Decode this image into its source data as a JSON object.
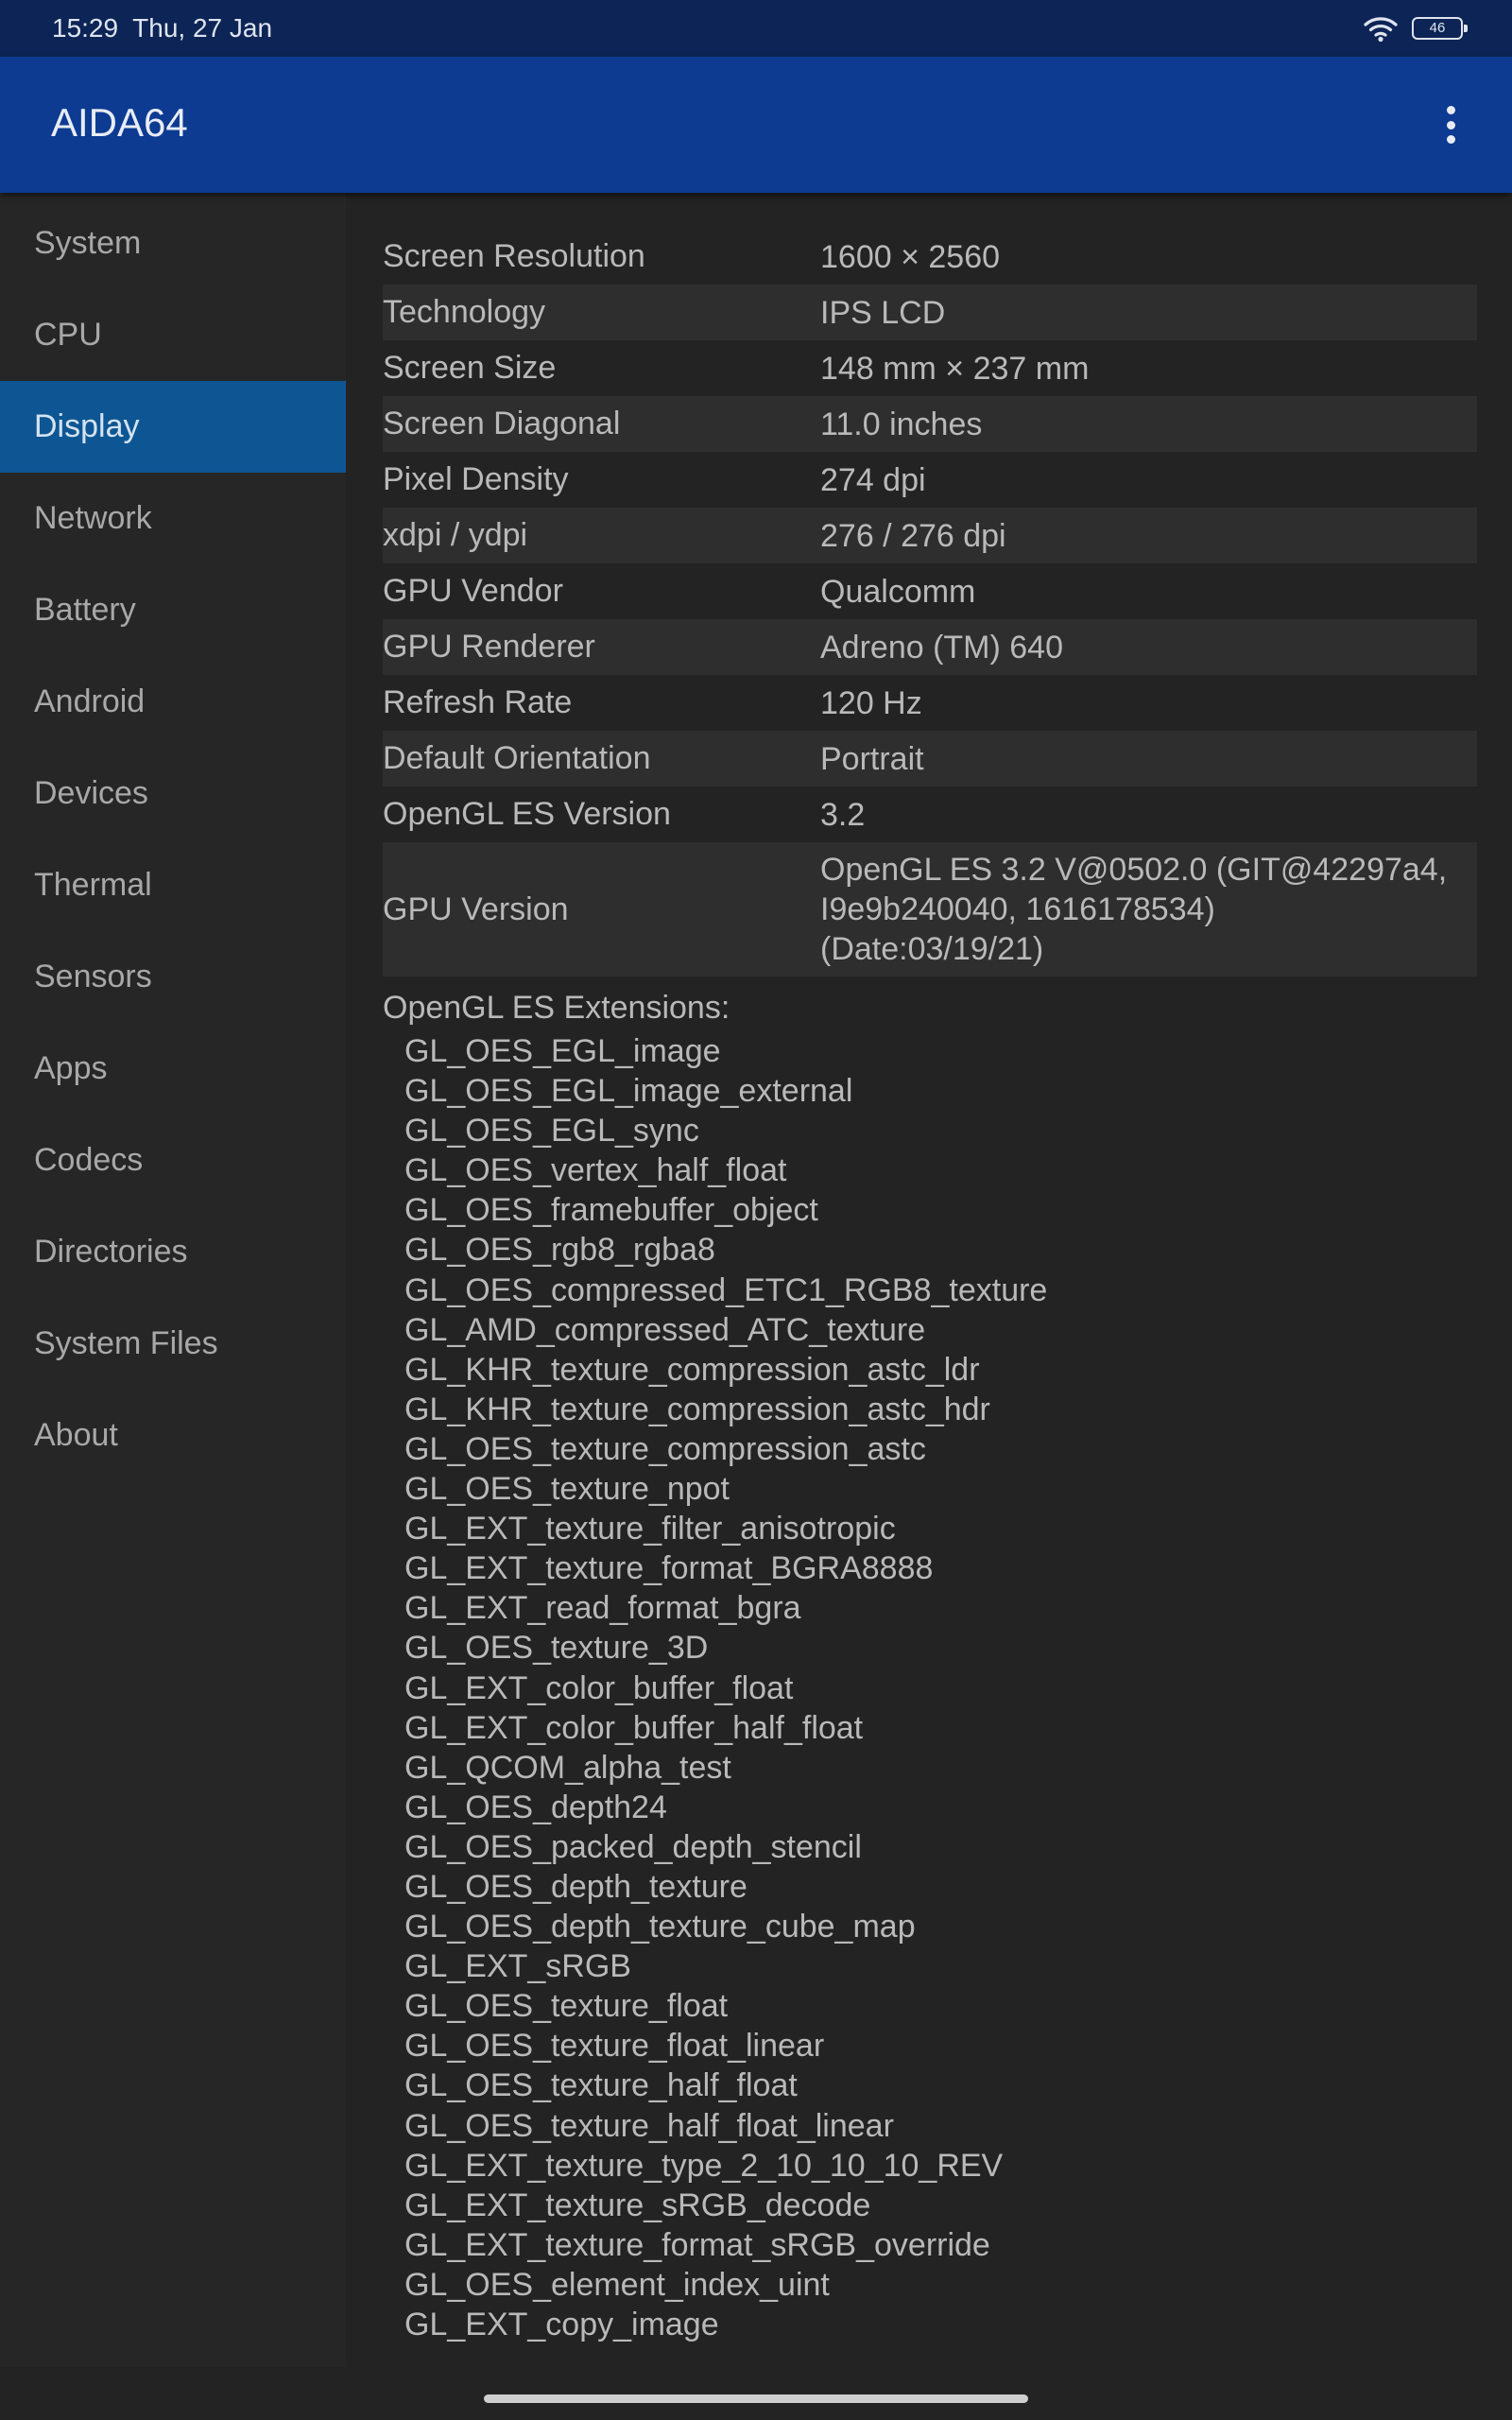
{
  "status": {
    "time": "15:29",
    "date": "Thu, 27 Jan",
    "battery": "46"
  },
  "app": {
    "title": "AIDA64"
  },
  "nav": [
    {
      "label": "System"
    },
    {
      "label": "CPU"
    },
    {
      "label": "Display"
    },
    {
      "label": "Network"
    },
    {
      "label": "Battery"
    },
    {
      "label": "Android"
    },
    {
      "label": "Devices"
    },
    {
      "label": "Thermal"
    },
    {
      "label": "Sensors"
    },
    {
      "label": "Apps"
    },
    {
      "label": "Codecs"
    },
    {
      "label": "Directories"
    },
    {
      "label": "System Files"
    },
    {
      "label": "About"
    }
  ],
  "selected_nav": "Display",
  "display": [
    {
      "label": "Screen Resolution",
      "value": "1600 × 2560"
    },
    {
      "label": "Technology",
      "value": "IPS LCD"
    },
    {
      "label": "Screen Size",
      "value": "148 mm × 237 mm"
    },
    {
      "label": "Screen Diagonal",
      "value": "11.0 inches"
    },
    {
      "label": "Pixel Density",
      "value": "274 dpi"
    },
    {
      "label": "xdpi / ydpi",
      "value": "276 / 276 dpi"
    },
    {
      "label": "GPU Vendor",
      "value": "Qualcomm"
    },
    {
      "label": "GPU Renderer",
      "value": "Adreno (TM) 640"
    },
    {
      "label": "Refresh Rate",
      "value": "120 Hz"
    },
    {
      "label": "Default Orientation",
      "value": "Portrait"
    },
    {
      "label": "OpenGL ES Version",
      "value": "3.2"
    }
  ],
  "gpu_version": {
    "label": "GPU Version",
    "lines": [
      "OpenGL ES 3.2 V@0502.0 (GIT@42297a4,",
      "I9e9b240040, 1616178534)",
      "(Date:03/19/21)"
    ]
  },
  "extensions_title": "OpenGL ES Extensions:",
  "extensions": [
    "GL_OES_EGL_image",
    "GL_OES_EGL_image_external",
    "GL_OES_EGL_sync",
    "GL_OES_vertex_half_float",
    "GL_OES_framebuffer_object",
    "GL_OES_rgb8_rgba8",
    "GL_OES_compressed_ETC1_RGB8_texture",
    "GL_AMD_compressed_ATC_texture",
    "GL_KHR_texture_compression_astc_ldr",
    "GL_KHR_texture_compression_astc_hdr",
    "GL_OES_texture_compression_astc",
    "GL_OES_texture_npot",
    "GL_EXT_texture_filter_anisotropic",
    "GL_EXT_texture_format_BGRA8888",
    "GL_EXT_read_format_bgra",
    "GL_OES_texture_3D",
    "GL_EXT_color_buffer_float",
    "GL_EXT_color_buffer_half_float",
    "GL_QCOM_alpha_test",
    "GL_OES_depth24",
    "GL_OES_packed_depth_stencil",
    "GL_OES_depth_texture",
    "GL_OES_depth_texture_cube_map",
    "GL_EXT_sRGB",
    "GL_OES_texture_float",
    "GL_OES_texture_float_linear",
    "GL_OES_texture_half_float",
    "GL_OES_texture_half_float_linear",
    "GL_EXT_texture_type_2_10_10_10_REV",
    "GL_EXT_texture_sRGB_decode",
    "GL_EXT_texture_format_sRGB_override",
    "GL_OES_element_index_uint",
    "GL_EXT_copy_image"
  ],
  "colors": {
    "status_bar": "#0d2556",
    "app_bar": "#0d3b92",
    "sidebar_selected": "#0d5693",
    "background": "#232323",
    "row_alt": "#2e2e2e"
  },
  "icons": [
    "wifi-icon",
    "battery-icon",
    "more-vert-icon"
  ]
}
